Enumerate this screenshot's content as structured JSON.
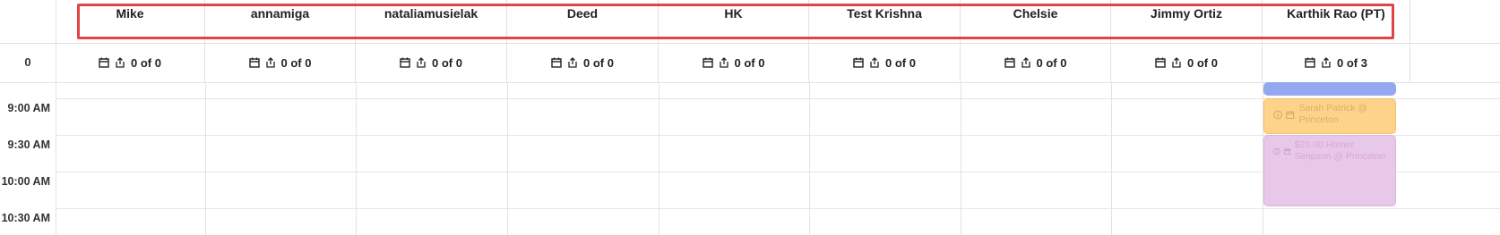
{
  "corner": {
    "summary_label": "0"
  },
  "providers": [
    {
      "name": "Mike",
      "count_label": "0 of 0"
    },
    {
      "name": "annamiga",
      "count_label": "0 of 0"
    },
    {
      "name": "nataliamusielak",
      "count_label": "0 of 0"
    },
    {
      "name": "Deed",
      "count_label": "0 of 0"
    },
    {
      "name": "HK",
      "count_label": "0 of 0"
    },
    {
      "name": "Test Krishna",
      "count_label": "0 of 0"
    },
    {
      "name": "Chelsie",
      "count_label": "0 of 0"
    },
    {
      "name": "Jimmy Ortiz",
      "count_label": "0 of 0"
    },
    {
      "name": "Karthik Rao (PT)",
      "count_label": "0 of 3"
    }
  ],
  "times": [
    "9:00 AM",
    "9:30 AM",
    "10:00 AM",
    "10:30 AM"
  ],
  "events": {
    "orange": {
      "text": "Sarah Patrick @ Princeton"
    },
    "purple": {
      "text": "$20.00 Homer Simpson @ Princeton"
    }
  },
  "colors": {
    "highlight": "#e04444",
    "event_blue": "#93a8ee",
    "event_orange": "#fdd38a",
    "event_purple": "#e8c8e8"
  }
}
